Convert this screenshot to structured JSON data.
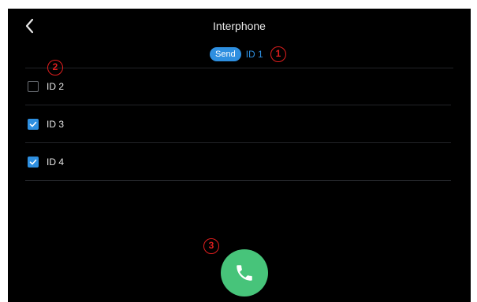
{
  "header": {
    "title": "Interphone"
  },
  "send": {
    "label": "Send",
    "id": "ID 1"
  },
  "devices": [
    {
      "label": "ID 2",
      "checked": false
    },
    {
      "label": "ID 3",
      "checked": true
    },
    {
      "label": "ID 4",
      "checked": true
    }
  ],
  "markers": [
    "1",
    "2",
    "3"
  ],
  "colors": {
    "accent": "#2e8fe0",
    "call": "#47c47a",
    "marker": "#e01e1e",
    "background": "#000000"
  },
  "icons": {
    "back": "chevron-left-icon",
    "call": "phone-icon",
    "check": "check-icon"
  }
}
